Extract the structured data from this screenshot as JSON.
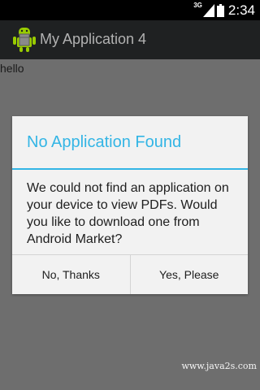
{
  "status_bar": {
    "network": "3G",
    "time": "2:34",
    "icons": [
      "signal-icon",
      "battery-icon"
    ]
  },
  "action_bar": {
    "icon": "android-app-icon",
    "title": "My Application 4"
  },
  "content": {
    "text": "hello"
  },
  "dialog": {
    "title": "No Application Found",
    "message": "We could not find an application on your device to view PDFs. Would you like to download one from Android Market?",
    "negative_label": "No, Thanks",
    "positive_label": "Yes, Please"
  },
  "watermark": "www.java2s.com",
  "colors": {
    "accent": "#33b5e5",
    "status_bar": "#000000",
    "action_bar": "#1f2122",
    "dim_background": "#6e6e6e",
    "dialog_background": "#f2f2f2",
    "app_icon_green": "#99cc00"
  }
}
